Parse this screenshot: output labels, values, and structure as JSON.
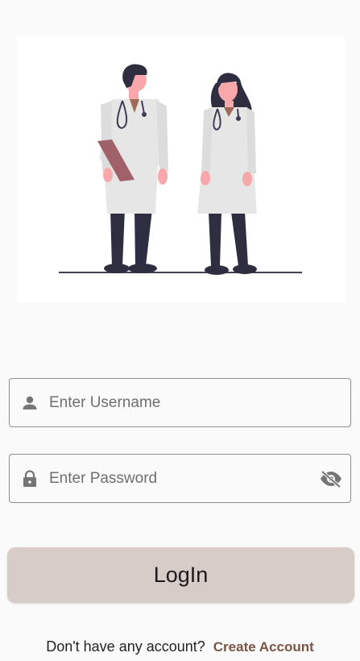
{
  "illustration": {
    "name": "two-doctors-illustration",
    "colors": {
      "coat": "#e6e6e6",
      "skin": "#f8a8ab",
      "hair": "#2f2e41",
      "pants": "#2f2e41",
      "clipboard": "#a0616a",
      "ground": "#3f3d56"
    }
  },
  "username": {
    "placeholder": "Enter Username",
    "icon": "person-icon"
  },
  "password": {
    "placeholder": "Enter Password",
    "icon": "lock-icon",
    "toggle_icon": "eye-off-icon"
  },
  "login": {
    "label": "LogIn",
    "color": "#d7ccc8"
  },
  "footer": {
    "prompt": "Don't have any account?",
    "link": "Create Account",
    "link_color": "#7a5545"
  }
}
